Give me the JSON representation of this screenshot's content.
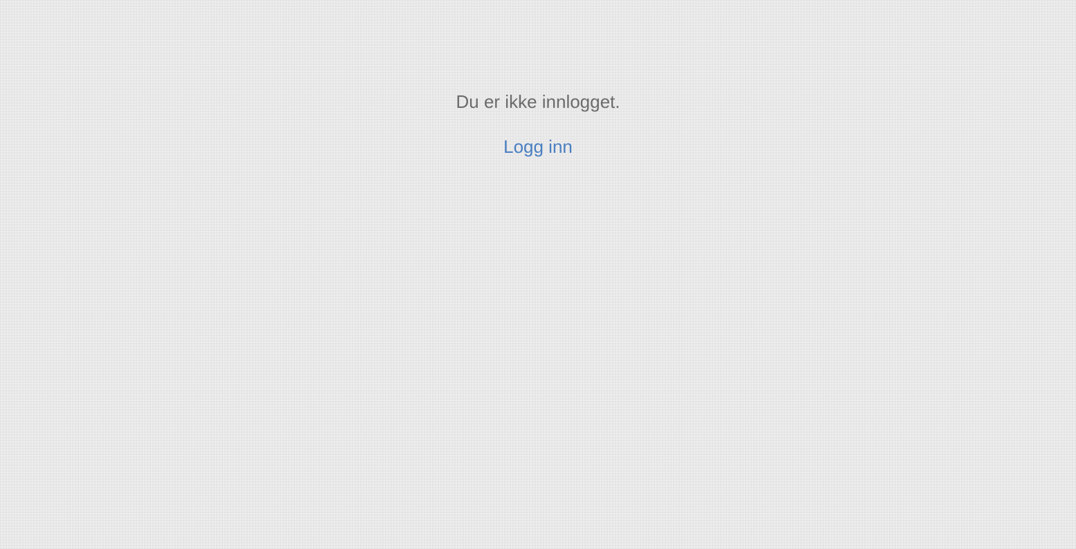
{
  "notice": {
    "message": "Du er ikke innlogget.",
    "login_label": "Logg inn"
  },
  "colors": {
    "background": "#e9e9e9",
    "message_text": "#6b6b6b",
    "link": "#4a7fc1"
  }
}
